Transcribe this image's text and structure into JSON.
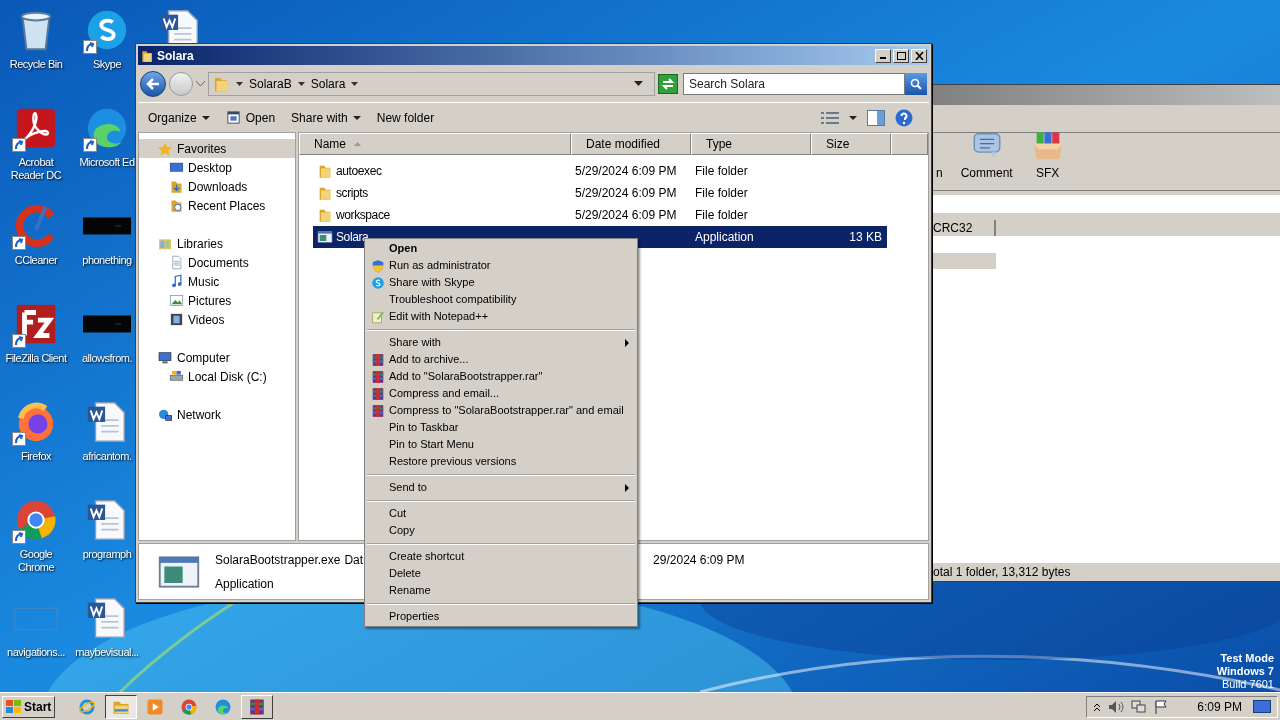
{
  "desktop_icons": [
    {
      "kind": "recycle",
      "label": "Recycle Bin",
      "shortcut": false
    },
    {
      "kind": "acrobat",
      "label": "Acrobat Reader DC",
      "shortcut": true
    },
    {
      "kind": "ccleaner",
      "label": "CCleaner",
      "shortcut": true
    },
    {
      "kind": "filezilla",
      "label": "FileZilla Client",
      "shortcut": true
    },
    {
      "kind": "firefox",
      "label": "Firefox",
      "shortcut": true
    },
    {
      "kind": "chrome",
      "label": "Google Chrome",
      "shortcut": true
    },
    {
      "kind": "blank",
      "label": "navigations...",
      "shortcut": false
    },
    {
      "kind": "skype",
      "label": "Skype",
      "shortcut": true
    },
    {
      "kind": "edge",
      "label": "Microsoft Ed",
      "shortcut": true
    },
    {
      "kind": "thumb",
      "label": "phonething",
      "shortcut": false
    },
    {
      "kind": "thumb",
      "label": "allowsfrom.",
      "shortcut": false
    },
    {
      "kind": "word",
      "label": "africantom.",
      "shortcut": false
    },
    {
      "kind": "word",
      "label": "programph",
      "shortcut": false
    },
    {
      "kind": "word",
      "label": "maybevisual...",
      "shortcut": false
    },
    {
      "kind": "word",
      "shortcut": false
    }
  ],
  "background_window": {
    "toolbar": [
      {
        "kind": "plain",
        "label": "n"
      },
      {
        "kind": "comment",
        "label": "Comment"
      },
      {
        "kind": "sfx",
        "label": "SFX"
      }
    ],
    "column": "CRC32",
    "status": "otal 1 folder, 13,312 bytes"
  },
  "explorer": {
    "title": "Solara",
    "breadcrumb": [
      "SolaraB",
      "Solara"
    ],
    "search_placeholder": "Search Solara",
    "toolbar": [
      {
        "kind": "plain",
        "label": "Organize",
        "dropdown": true
      },
      {
        "kind": "open",
        "label": "Open",
        "dropdown": false
      },
      {
        "kind": "plain",
        "label": "Share with",
        "dropdown": true
      },
      {
        "kind": "plain",
        "label": "New folder",
        "dropdown": false
      }
    ],
    "nav": [
      {
        "kind": "star",
        "label": "Favorites",
        "selected": true,
        "children": [
          {
            "kind": "desktop",
            "label": "Desktop",
            "selected": false
          },
          {
            "kind": "downloads",
            "label": "Downloads",
            "selected": false
          },
          {
            "kind": "recent",
            "label": "Recent Places",
            "selected": false
          }
        ]
      },
      {
        "kind": "libraries",
        "label": "Libraries",
        "selected": false,
        "children": [
          {
            "kind": "documents",
            "label": "Documents",
            "selected": false
          },
          {
            "kind": "music",
            "label": "Music",
            "selected": false
          },
          {
            "kind": "pictures",
            "label": "Pictures",
            "selected": false
          },
          {
            "kind": "videos",
            "label": "Videos",
            "selected": false
          }
        ]
      },
      {
        "kind": "computer",
        "label": "Computer",
        "selected": false,
        "children": [
          {
            "kind": "disk",
            "label": "Local Disk (C:)",
            "selected": false
          }
        ]
      },
      {
        "kind": "network",
        "label": "Network",
        "selected": false
      }
    ],
    "columns": [
      {
        "label": "Name",
        "sorted": true
      },
      {
        "label": "Date modified",
        "sorted": false
      },
      {
        "label": "Type",
        "sorted": false
      },
      {
        "label": "Size",
        "sorted": false
      }
    ],
    "rows": [
      {
        "kind": "folder",
        "name": "autoexec",
        "date": "5/29/2024 6:09 PM",
        "type": "File folder",
        "selected": false
      },
      {
        "kind": "folder",
        "name": "scripts",
        "date": "5/29/2024 6:09 PM",
        "type": "File folder",
        "selected": false
      },
      {
        "kind": "folder",
        "name": "workspace",
        "date": "5/29/2024 6:09 PM",
        "type": "File folder",
        "selected": false
      },
      {
        "kind": "app",
        "name": "Solara",
        "type": "Application",
        "size": "13 KB",
        "selected": true
      }
    ],
    "details": {
      "name": "SolaraBootstrapper.exe",
      "date_label": "Dat",
      "date": "29/2024 6:09 PM",
      "type": "Application"
    }
  },
  "context_menu": {
    "groups": [
      [
        {
          "kind": "plain",
          "label": "Open",
          "default": true,
          "submenu": false
        },
        {
          "kind": "shield",
          "label": "Run as administrator",
          "default": false,
          "submenu": false
        },
        {
          "kind": "skype",
          "label": "Share with Skype",
          "default": false,
          "submenu": false
        },
        {
          "kind": "plain",
          "label": "Troubleshoot compatibility",
          "default": false,
          "submenu": false
        },
        {
          "kind": "notepad",
          "label": "Edit with Notepad++",
          "default": false,
          "submenu": false
        }
      ],
      [
        {
          "kind": "plain",
          "label": "Share with",
          "default": false,
          "submenu": true
        },
        {
          "kind": "winrar",
          "label": "Add to archive...",
          "default": false,
          "submenu": false
        },
        {
          "kind": "winrar",
          "label": "Add to \"SolaraBootstrapper.rar\"",
          "default": false,
          "submenu": false
        },
        {
          "kind": "winrar",
          "label": "Compress and email...",
          "default": false,
          "submenu": false
        },
        {
          "kind": "winrar",
          "label": "Compress to \"SolaraBootstrapper.rar\" and email",
          "default": false,
          "submenu": false
        },
        {
          "kind": "plain",
          "label": "Pin to Taskbar",
          "default": false,
          "submenu": false
        },
        {
          "kind": "plain",
          "label": "Pin to Start Menu",
          "default": false,
          "submenu": false
        },
        {
          "kind": "plain",
          "label": "Restore previous versions",
          "default": false,
          "submenu": false
        }
      ],
      [
        {
          "kind": "plain",
          "label": "Send to",
          "default": false,
          "submenu": true
        }
      ],
      [
        {
          "kind": "plain",
          "label": "Cut",
          "default": false,
          "submenu": false
        },
        {
          "kind": "plain",
          "label": "Copy",
          "default": false,
          "submenu": false
        }
      ],
      [
        {
          "kind": "plain",
          "label": "Create shortcut",
          "default": false,
          "submenu": false
        },
        {
          "kind": "plain",
          "label": "Delete",
          "default": false,
          "submenu": false
        },
        {
          "kind": "plain",
          "label": "Rename",
          "default": false,
          "submenu": false
        }
      ],
      [
        {
          "kind": "plain",
          "label": "Properties",
          "default": false,
          "submenu": false
        }
      ]
    ]
  },
  "os_notice": [
    "Test Mode",
    "Windows 7",
    "Build 7601"
  ],
  "taskbar": {
    "start": "Start",
    "apps": [
      {
        "kind": "ie",
        "open": false,
        "selected": false
      },
      {
        "kind": "explorer",
        "open": true,
        "selected": true
      },
      {
        "kind": "media",
        "open": false,
        "selected": false
      },
      {
        "kind": "chrome",
        "open": false,
        "selected": false
      },
      {
        "kind": "edge",
        "open": false,
        "selected": false
      },
      {
        "kind": "winrar",
        "open": true,
        "selected": false
      }
    ],
    "clock": "6:09 PM"
  }
}
